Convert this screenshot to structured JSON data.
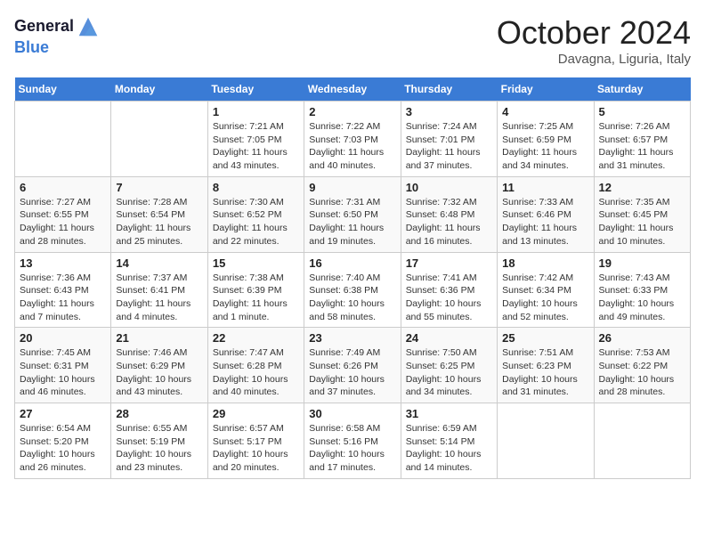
{
  "header": {
    "logo_line1": "General",
    "logo_line2": "Blue",
    "month": "October 2024",
    "location": "Davagna, Liguria, Italy"
  },
  "weekdays": [
    "Sunday",
    "Monday",
    "Tuesday",
    "Wednesday",
    "Thursday",
    "Friday",
    "Saturday"
  ],
  "weeks": [
    [
      {
        "day": "",
        "info": ""
      },
      {
        "day": "",
        "info": ""
      },
      {
        "day": "1",
        "info": "Sunrise: 7:21 AM\nSunset: 7:05 PM\nDaylight: 11 hours and 43 minutes."
      },
      {
        "day": "2",
        "info": "Sunrise: 7:22 AM\nSunset: 7:03 PM\nDaylight: 11 hours and 40 minutes."
      },
      {
        "day": "3",
        "info": "Sunrise: 7:24 AM\nSunset: 7:01 PM\nDaylight: 11 hours and 37 minutes."
      },
      {
        "day": "4",
        "info": "Sunrise: 7:25 AM\nSunset: 6:59 PM\nDaylight: 11 hours and 34 minutes."
      },
      {
        "day": "5",
        "info": "Sunrise: 7:26 AM\nSunset: 6:57 PM\nDaylight: 11 hours and 31 minutes."
      }
    ],
    [
      {
        "day": "6",
        "info": "Sunrise: 7:27 AM\nSunset: 6:55 PM\nDaylight: 11 hours and 28 minutes."
      },
      {
        "day": "7",
        "info": "Sunrise: 7:28 AM\nSunset: 6:54 PM\nDaylight: 11 hours and 25 minutes."
      },
      {
        "day": "8",
        "info": "Sunrise: 7:30 AM\nSunset: 6:52 PM\nDaylight: 11 hours and 22 minutes."
      },
      {
        "day": "9",
        "info": "Sunrise: 7:31 AM\nSunset: 6:50 PM\nDaylight: 11 hours and 19 minutes."
      },
      {
        "day": "10",
        "info": "Sunrise: 7:32 AM\nSunset: 6:48 PM\nDaylight: 11 hours and 16 minutes."
      },
      {
        "day": "11",
        "info": "Sunrise: 7:33 AM\nSunset: 6:46 PM\nDaylight: 11 hours and 13 minutes."
      },
      {
        "day": "12",
        "info": "Sunrise: 7:35 AM\nSunset: 6:45 PM\nDaylight: 11 hours and 10 minutes."
      }
    ],
    [
      {
        "day": "13",
        "info": "Sunrise: 7:36 AM\nSunset: 6:43 PM\nDaylight: 11 hours and 7 minutes."
      },
      {
        "day": "14",
        "info": "Sunrise: 7:37 AM\nSunset: 6:41 PM\nDaylight: 11 hours and 4 minutes."
      },
      {
        "day": "15",
        "info": "Sunrise: 7:38 AM\nSunset: 6:39 PM\nDaylight: 11 hours and 1 minute."
      },
      {
        "day": "16",
        "info": "Sunrise: 7:40 AM\nSunset: 6:38 PM\nDaylight: 10 hours and 58 minutes."
      },
      {
        "day": "17",
        "info": "Sunrise: 7:41 AM\nSunset: 6:36 PM\nDaylight: 10 hours and 55 minutes."
      },
      {
        "day": "18",
        "info": "Sunrise: 7:42 AM\nSunset: 6:34 PM\nDaylight: 10 hours and 52 minutes."
      },
      {
        "day": "19",
        "info": "Sunrise: 7:43 AM\nSunset: 6:33 PM\nDaylight: 10 hours and 49 minutes."
      }
    ],
    [
      {
        "day": "20",
        "info": "Sunrise: 7:45 AM\nSunset: 6:31 PM\nDaylight: 10 hours and 46 minutes."
      },
      {
        "day": "21",
        "info": "Sunrise: 7:46 AM\nSunset: 6:29 PM\nDaylight: 10 hours and 43 minutes."
      },
      {
        "day": "22",
        "info": "Sunrise: 7:47 AM\nSunset: 6:28 PM\nDaylight: 10 hours and 40 minutes."
      },
      {
        "day": "23",
        "info": "Sunrise: 7:49 AM\nSunset: 6:26 PM\nDaylight: 10 hours and 37 minutes."
      },
      {
        "day": "24",
        "info": "Sunrise: 7:50 AM\nSunset: 6:25 PM\nDaylight: 10 hours and 34 minutes."
      },
      {
        "day": "25",
        "info": "Sunrise: 7:51 AM\nSunset: 6:23 PM\nDaylight: 10 hours and 31 minutes."
      },
      {
        "day": "26",
        "info": "Sunrise: 7:53 AM\nSunset: 6:22 PM\nDaylight: 10 hours and 28 minutes."
      }
    ],
    [
      {
        "day": "27",
        "info": "Sunrise: 6:54 AM\nSunset: 5:20 PM\nDaylight: 10 hours and 26 minutes."
      },
      {
        "day": "28",
        "info": "Sunrise: 6:55 AM\nSunset: 5:19 PM\nDaylight: 10 hours and 23 minutes."
      },
      {
        "day": "29",
        "info": "Sunrise: 6:57 AM\nSunset: 5:17 PM\nDaylight: 10 hours and 20 minutes."
      },
      {
        "day": "30",
        "info": "Sunrise: 6:58 AM\nSunset: 5:16 PM\nDaylight: 10 hours and 17 minutes."
      },
      {
        "day": "31",
        "info": "Sunrise: 6:59 AM\nSunset: 5:14 PM\nDaylight: 10 hours and 14 minutes."
      },
      {
        "day": "",
        "info": ""
      },
      {
        "day": "",
        "info": ""
      }
    ]
  ]
}
